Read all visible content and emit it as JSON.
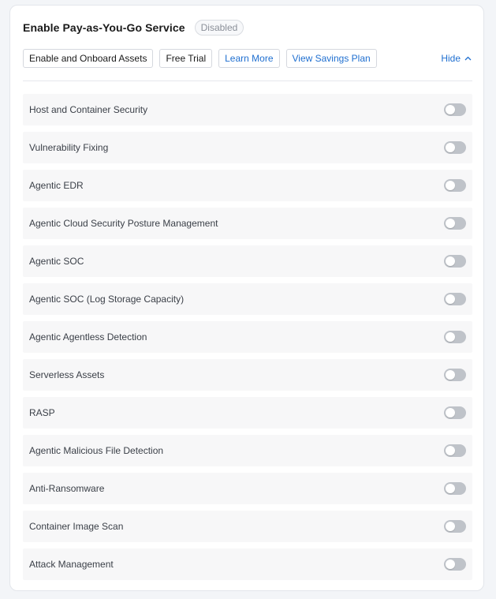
{
  "header": {
    "title": "Enable Pay-as-You-Go Service",
    "status_badge": "Disabled"
  },
  "actions": {
    "enable_onboard": "Enable and Onboard Assets",
    "free_trial": "Free Trial",
    "learn_more": "Learn More",
    "view_savings_plan": "View Savings Plan",
    "hide": "Hide"
  },
  "services": [
    {
      "label": "Host and Container Security",
      "enabled": false
    },
    {
      "label": "Vulnerability Fixing",
      "enabled": false
    },
    {
      "label": "Agentic EDR",
      "enabled": false
    },
    {
      "label": "Agentic Cloud Security Posture Management",
      "enabled": false
    },
    {
      "label": "Agentic SOC",
      "enabled": false
    },
    {
      "label": "Agentic SOC (Log Storage Capacity)",
      "enabled": false
    },
    {
      "label": "Agentic Agentless Detection",
      "enabled": false
    },
    {
      "label": "Serverless Assets",
      "enabled": false
    },
    {
      "label": "RASP",
      "enabled": false
    },
    {
      "label": "Agentic Malicious File Detection",
      "enabled": false
    },
    {
      "label": "Anti-Ransomware",
      "enabled": false
    },
    {
      "label": "Container Image Scan",
      "enabled": false
    },
    {
      "label": "Attack Management",
      "enabled": false
    }
  ],
  "colors": {
    "link": "#1f6fd0",
    "toggle_off": "#bfc3c9",
    "row_bg": "#f7f7f8"
  }
}
